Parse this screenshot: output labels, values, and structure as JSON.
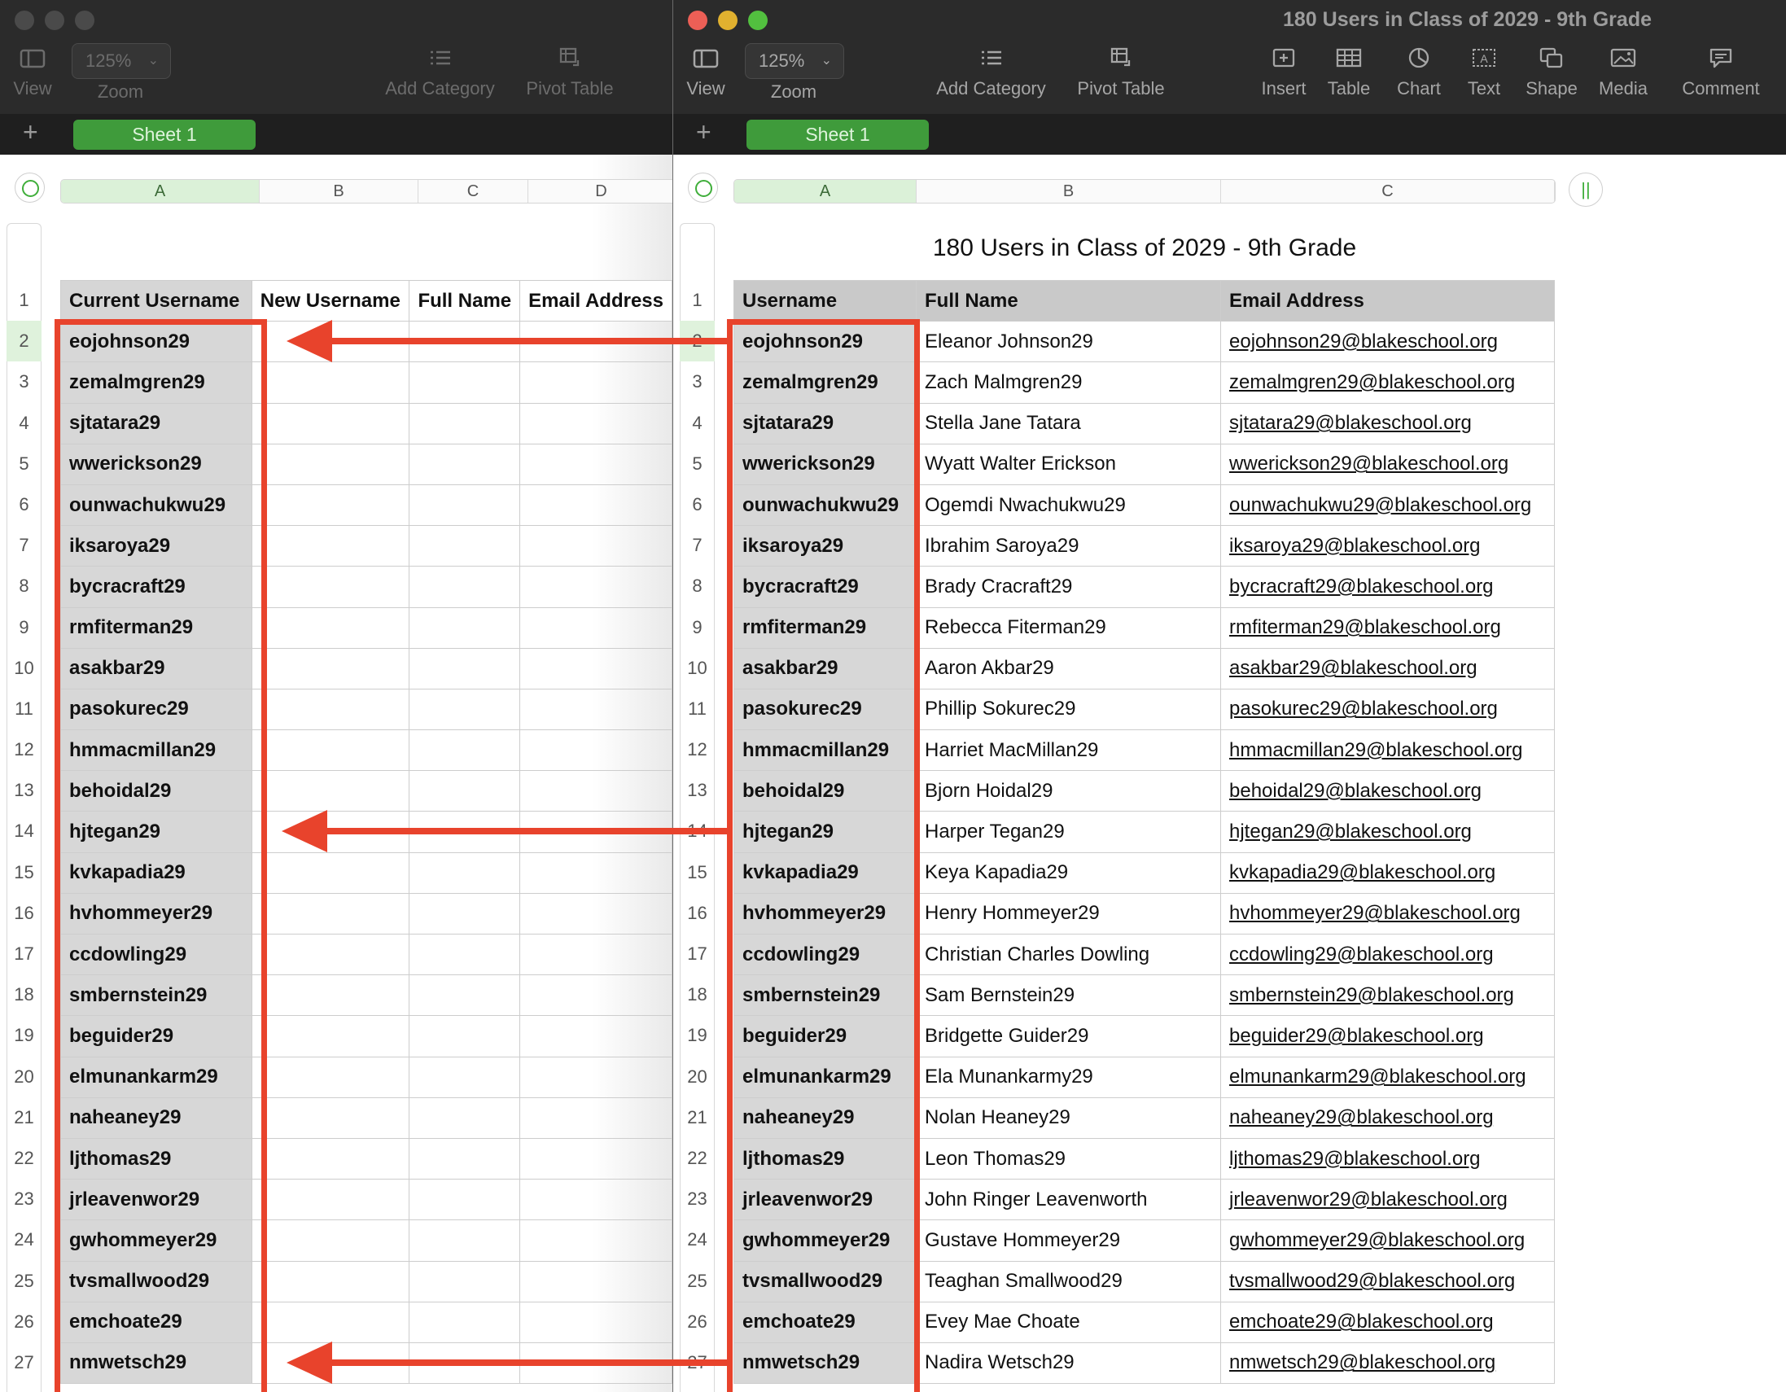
{
  "left_window": {
    "toolbar": {
      "view": "View",
      "zoom_value": "125%",
      "zoom": "Zoom",
      "add_category": "Add Category",
      "pivot_table": "Pivot Table"
    },
    "tab": "Sheet 1",
    "plus": "+",
    "column_letters": [
      "A",
      "B",
      "C",
      "D"
    ],
    "headers": [
      "Current Username",
      "New Username",
      "Full Name",
      "Email Address"
    ]
  },
  "right_window": {
    "title": "180 Users in Class of 2029 - 9th Grade",
    "toolbar": {
      "view": "View",
      "zoom_value": "125%",
      "zoom": "Zoom",
      "add_category": "Add Category",
      "pivot_table": "Pivot Table",
      "insert": "Insert",
      "table": "Table",
      "chart": "Chart",
      "text": "Text",
      "shape": "Shape",
      "media": "Media",
      "comment": "Comment"
    },
    "tab": "Sheet 1",
    "plus": "+",
    "column_letters": [
      "A",
      "B",
      "C"
    ],
    "pause_glyph": "||",
    "table_title": "180 Users in Class of 2029 - 9th Grade",
    "headers": [
      "Username",
      "Full Name",
      "Email Address"
    ]
  },
  "row_numbers": [
    "1",
    "2",
    "3",
    "4",
    "5",
    "6",
    "7",
    "8",
    "9",
    "10",
    "11",
    "12",
    "13",
    "14",
    "15",
    "16",
    "17",
    "18",
    "19",
    "20",
    "21",
    "22",
    "23",
    "24",
    "25",
    "26",
    "27"
  ],
  "users": [
    {
      "username": "eojohnson29",
      "full_name": "Eleanor Johnson29",
      "email": "eojohnson29@blakeschool.org"
    },
    {
      "username": "zemalmgren29",
      "full_name": "Zach Malmgren29",
      "email": "zemalmgren29@blakeschool.org"
    },
    {
      "username": "sjtatara29",
      "full_name": "Stella Jane Tatara",
      "email": "sjtatara29@blakeschool.org"
    },
    {
      "username": "wwerickson29",
      "full_name": "Wyatt Walter Erickson",
      "email": "wwerickson29@blakeschool.org"
    },
    {
      "username": "ounwachukwu29",
      "full_name": "Ogemdi Nwachukwu29",
      "email": "ounwachukwu29@blakeschool.org"
    },
    {
      "username": "iksaroya29",
      "full_name": "Ibrahim Saroya29",
      "email": "iksaroya29@blakeschool.org"
    },
    {
      "username": "bycracraft29",
      "full_name": "Brady Cracraft29",
      "email": "bycracraft29@blakeschool.org"
    },
    {
      "username": "rmfiterman29",
      "full_name": "Rebecca Fiterman29",
      "email": "rmfiterman29@blakeschool.org"
    },
    {
      "username": "asakbar29",
      "full_name": "Aaron Akbar29",
      "email": "asakbar29@blakeschool.org"
    },
    {
      "username": "pasokurec29",
      "full_name": "Phillip Sokurec29",
      "email": "pasokurec29@blakeschool.org"
    },
    {
      "username": "hmmacmillan29",
      "full_name": "Harriet MacMillan29",
      "email": "hmmacmillan29@blakeschool.org"
    },
    {
      "username": "behoidal29",
      "full_name": "Bjorn Hoidal29",
      "email": "behoidal29@blakeschool.org"
    },
    {
      "username": "hjtegan29",
      "full_name": "Harper Tegan29",
      "email": "hjtegan29@blakeschool.org"
    },
    {
      "username": "kvkapadia29",
      "full_name": "Keya Kapadia29",
      "email": "kvkapadia29@blakeschool.org"
    },
    {
      "username": "hvhommeyer29",
      "full_name": "Henry Hommeyer29",
      "email": "hvhommeyer29@blakeschool.org"
    },
    {
      "username": "ccdowling29",
      "full_name": "Christian Charles Dowling",
      "email": "ccdowling29@blakeschool.org"
    },
    {
      "username": "smbernstein29",
      "full_name": "Sam Bernstein29",
      "email": "smbernstein29@blakeschool.org"
    },
    {
      "username": "beguider29",
      "full_name": "Bridgette Guider29",
      "email": "beguider29@blakeschool.org"
    },
    {
      "username": "elmunankarm29",
      "full_name": "Ela Munankarmy29",
      "email": "elmunankarm29@blakeschool.org"
    },
    {
      "username": "naheaney29",
      "full_name": "Nolan Heaney29",
      "email": "naheaney29@blakeschool.org"
    },
    {
      "username": "ljthomas29",
      "full_name": "Leon Thomas29",
      "email": "ljthomas29@blakeschool.org"
    },
    {
      "username": "jrleavenwor29",
      "full_name": "John Ringer Leavenworth",
      "email": "jrleavenwor29@blakeschool.org"
    },
    {
      "username": "gwhommeyer29",
      "full_name": "Gustave Hommeyer29",
      "email": "gwhommeyer29@blakeschool.org"
    },
    {
      "username": "tvsmallwood29",
      "full_name": "Teaghan Smallwood29",
      "email": "tvsmallwood29@blakeschool.org"
    },
    {
      "username": "emchoate29",
      "full_name": "Evey Mae Choate",
      "email": "emchoate29@blakeschool.org"
    },
    {
      "username": "nmwetsch29",
      "full_name": "Nadira Wetsch29",
      "email": "nmwetsch29@blakeschool.org"
    }
  ],
  "colors": {
    "annotation_red": "#e8432c",
    "sheet_tab_green": "#3f9b3b",
    "traffic_red": "#ec5f56",
    "traffic_yellow": "#e1b12f",
    "traffic_green": "#52c03f",
    "traffic_inactive": "#4a4a4a"
  }
}
